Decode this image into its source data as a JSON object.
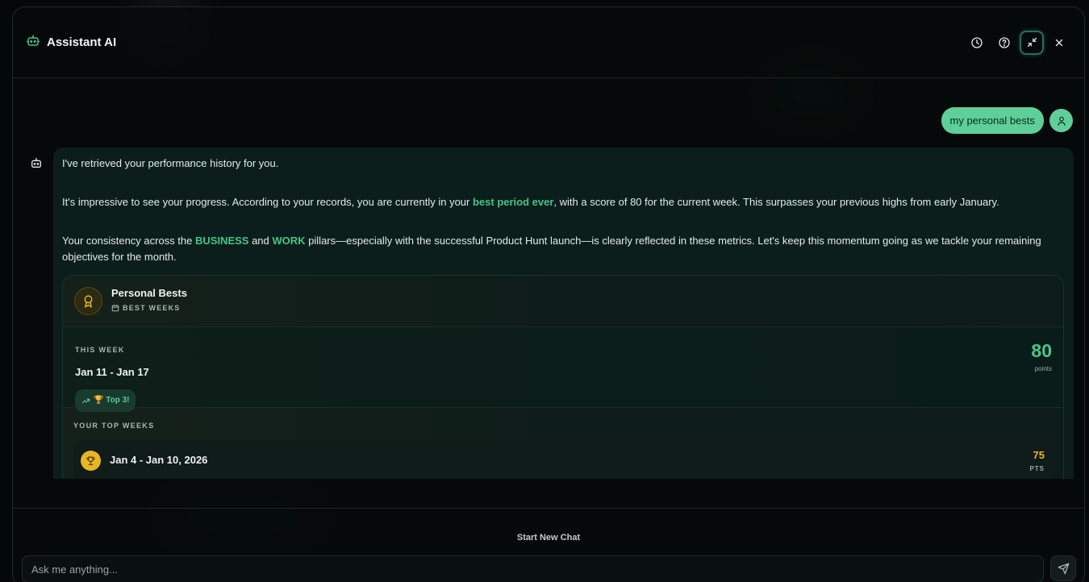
{
  "header": {
    "title": "Assistant AI",
    "icons": [
      "robot-icon",
      "history-icon",
      "help-icon",
      "minimize-icon",
      "close-icon"
    ]
  },
  "user_message": "my personal bests",
  "bot_message": {
    "p1": "I've retrieved your performance history for you.",
    "p2_a": "It's impressive to see your progress. According to your records, you are currently in your ",
    "p2_hl": "best period ever",
    "p2_b": ", with a score of 80 for the current week. This surpasses your previous highs from early January.",
    "p3_a": "Your consistency across the ",
    "p3_hl1": "BUSINESS",
    "p3_mid": " and ",
    "p3_hl2": "WORK",
    "p3_b": " pillars—especially with the successful Product Hunt launch—is clearly reflected in these metrics. Let's keep this momentum going as we tackle your remaining objectives for the month."
  },
  "card": {
    "title": "Personal Bests",
    "subtitle": "BEST WEEKS",
    "this_week_label": "THIS WEEK",
    "this_week_range": "Jan 11 - Jan 17",
    "badge": "🏆 Top 3!",
    "score": "80",
    "score_unit": "points",
    "top_weeks_label": "YOUR TOP WEEKS",
    "top_weeks": [
      {
        "range": "Jan 4 - Jan 10, 2026",
        "score": "75",
        "unit": "PTS"
      }
    ]
  },
  "footer": {
    "new_chat": "Start New Chat",
    "input_placeholder": "Ask me anything..."
  },
  "colors": {
    "accent": "#45c48a",
    "user_bubble": "#5fcf9a",
    "gold": "#e8b623"
  }
}
